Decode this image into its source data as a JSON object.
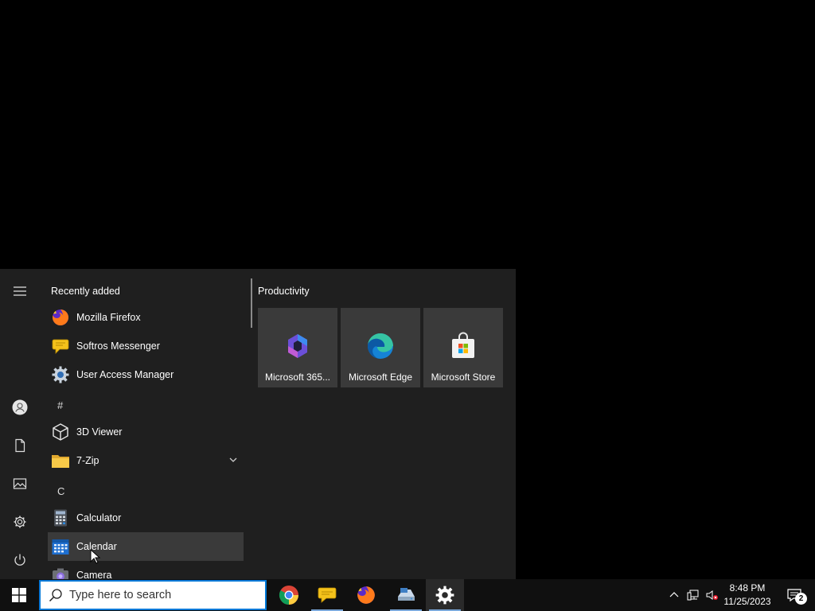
{
  "start_menu": {
    "list_header": "Recently added",
    "recent": [
      {
        "label": "Mozilla Firefox",
        "icon": "firefox-icon"
      },
      {
        "label": "Softros Messenger",
        "icon": "softros-messenger-icon"
      },
      {
        "label": "User Access Manager",
        "icon": "gear-icon"
      }
    ],
    "groups": [
      {
        "letter": "#",
        "apps": [
          {
            "label": "3D Viewer",
            "icon": "cube-icon"
          },
          {
            "label": "7-Zip",
            "icon": "folder-icon",
            "expandable": true
          }
        ]
      },
      {
        "letter": "C",
        "apps": [
          {
            "label": "Calculator",
            "icon": "calculator-icon"
          },
          {
            "label": "Calendar",
            "icon": "calendar-icon"
          },
          {
            "label": "Camera",
            "icon": "camera-icon"
          }
        ]
      }
    ],
    "tiles_group": "Productivity",
    "tiles": [
      {
        "label": "Microsoft 365...",
        "icon": "microsoft-365-icon"
      },
      {
        "label": "Microsoft Edge",
        "icon": "edge-icon"
      },
      {
        "label": "Microsoft Store",
        "icon": "store-icon"
      }
    ]
  },
  "taskbar": {
    "search_placeholder": "Type here to search",
    "pinned": [
      "chrome-icon",
      "softros-messenger-icon",
      "firefox-icon",
      "network-drive-icon",
      "settings-icon"
    ],
    "clock_time": "8:48 PM",
    "clock_date": "11/25/2023",
    "notification_count": "2"
  },
  "colors": {
    "menu_bg": "#1f1f1f",
    "tile_bg": "#3a3a3a",
    "taskbar_bg": "#101010",
    "accent": "#0078d7"
  }
}
